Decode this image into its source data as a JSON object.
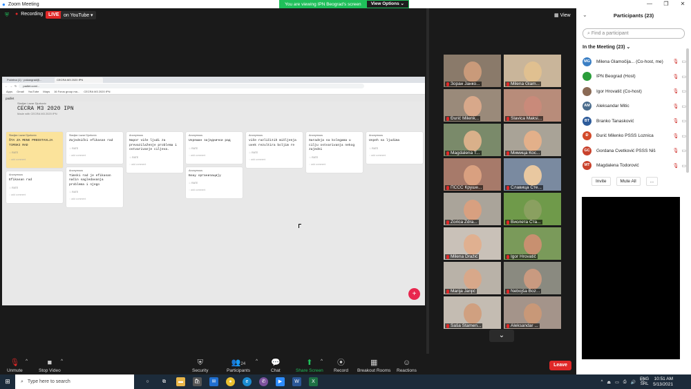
{
  "window": {
    "title": "Zoom Meeting"
  },
  "banner": {
    "viewing": "You are viewing IPN Beograd's screen",
    "view_options": "View Options ⌄"
  },
  "topbar": {
    "recording": "Recording",
    "live": "LIVE",
    "youtube": "on YouTube ▾",
    "view": "View"
  },
  "shared": {
    "tabs": [
      "Početna (1) · pokangrad@...",
      "CECRA M3 2020 IPN"
    ],
    "url": "padlet.com/...",
    "bookmarks": [
      "Apps",
      "Gmail",
      "YouTube",
      "Maps",
      "16 Forus group ma...",
      "CECRA M3 2020 IPN"
    ],
    "padlet_brand": "padlet",
    "author": "Sladjan Lazar Djurkovic",
    "title": "CECRA M3 2020 IPN",
    "subtitle": "Made with CECRA M3 2020 IPN",
    "columns": [
      {
        "cards": [
          {
            "author": "Sladjan Lazar Djurkovic",
            "body": "ŠTA ZA MENE PREDSTAVLJA TIMSKI RAD",
            "highlight": true
          },
          {
            "author": "Anonymous",
            "body": "Efikasan rad"
          }
        ]
      },
      {
        "cards": [
          {
            "author": "Sladjan Lazar Djurkovic",
            "body": "Zajednički efikasan rad"
          },
          {
            "author": "Anonymous",
            "body": "Timski rad je efikasan način sagledavanja problema i njego"
          }
        ]
      },
      {
        "cards": [
          {
            "author": "Anonymous",
            "body": "Napor više ljudi za prevazilaženje problema i ostvarivanje ciljeva."
          }
        ]
      },
      {
        "cards": [
          {
            "author": "Anonymous",
            "body": "Uspeшан заједнички рад"
          },
          {
            "author": "Anonymous",
            "body": "Бољу организацију"
          }
        ]
      },
      {
        "cards": [
          {
            "author": "Anonymous",
            "body": "više različitih mišljenja uvek rezultira boljim re"
          }
        ]
      },
      {
        "cards": [
          {
            "author": "Anonymous",
            "body": "Saradnja sa kolegama u cilju ostvarivanja nekog zajedni"
          }
        ]
      },
      {
        "cards": [
          {
            "author": "Anonymous",
            "body": "Uspeh sa ljudima"
          }
        ]
      }
    ],
    "rate": "RATE",
    "add_comment": "add comment",
    "fab": "+"
  },
  "gallery": [
    {
      "name": "Зоран Јанко..."
    },
    {
      "name": "Milena Glam..."
    },
    {
      "name": "Đurić Milenk..."
    },
    {
      "name": "Slavica Maksi..."
    },
    {
      "name": "Magdalena T..."
    },
    {
      "name": "Мимица Кос..."
    },
    {
      "name": "ПССС Круше..."
    },
    {
      "name": "Славица Сте..."
    },
    {
      "name": "Zorica Zdra..."
    },
    {
      "name": "Виолета Ста..."
    },
    {
      "name": "Milena Dražić"
    },
    {
      "name": "Igor Hrovatič"
    },
    {
      "name": "Marija Janjić"
    },
    {
      "name": "Nebojša Boz..."
    },
    {
      "name": "Saša Stamen..."
    },
    {
      "name": "Aleksandar ..."
    }
  ],
  "toolbar": {
    "unmute": "Unmute",
    "stop_video": "Stop Video",
    "security": "Security",
    "participants": "Participants",
    "participants_count": "24",
    "chat": "Chat",
    "share": "Share Screen",
    "record": "Record",
    "breakout": "Breakout Rooms",
    "reactions": "Reactions",
    "leave": "Leave"
  },
  "panel": {
    "title": "Participants (23)",
    "search_placeholder": "Find a participant",
    "in_meeting": "In the Meeting (23)",
    "participants": [
      {
        "initials": "MG",
        "name": "Milena Glamočija... (Co-host, me)",
        "color": "#3b7fc4"
      },
      {
        "initials": "",
        "name": "IPN Beograd (Host)",
        "color": "#2a9d3a"
      },
      {
        "initials": "",
        "name": "Igor Hrovatič (Co-host)",
        "color": "#8a6a55"
      },
      {
        "initials": "AM",
        "name": "Aleksandar Mitic",
        "color": "#4a6c8c"
      },
      {
        "initials": "BT",
        "name": "Branko Tanasković",
        "color": "#2d5b9a"
      },
      {
        "initials": "Đ",
        "name": "Đurić Milenko PSSS Loznica",
        "color": "#d34a2a"
      },
      {
        "initials": "GC",
        "name": "Gordana Cvetković PSSS Niš",
        "color": "#c9422c"
      },
      {
        "initials": "MT",
        "name": "Magdalena Todorović",
        "color": "#c9422c"
      }
    ],
    "invite": "Invite",
    "mute_all": "Mute All",
    "more": "..."
  },
  "taskbar": {
    "search": "Type here to search",
    "lang1": "ENG",
    "lang2": "SRL",
    "time": "10:51 AM",
    "date": "5/13/2021"
  }
}
